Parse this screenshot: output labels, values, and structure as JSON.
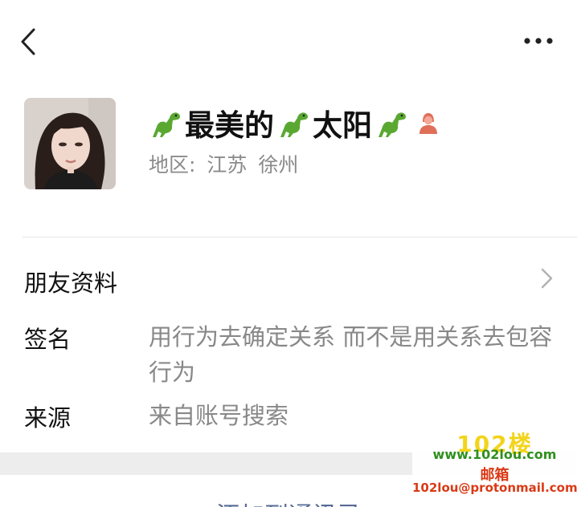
{
  "header": {
    "back_icon": "chevron-left-icon",
    "more_icon": "more-dots-icon"
  },
  "profile": {
    "name_parts": [
      "最美的",
      "太阳"
    ],
    "name_emoji": "dinosaur-emoji",
    "gender_icon": "female-gender-icon",
    "region_label": "地区:",
    "region_province": "江苏",
    "region_city": "徐州"
  },
  "rows": {
    "friend_info_label": "朋友资料",
    "signature_label": "签名",
    "signature_value": "用行为去确定关系 而不是用关系去包容行为",
    "source_label": "来源",
    "source_value": "来自账号搜索"
  },
  "bottom": {
    "action_label": "添加到通讯录"
  },
  "watermark": {
    "logo": "102楼",
    "site": "www.102lou.com",
    "mail_label": "邮箱",
    "email": "102lou@protonmail.com"
  },
  "colors": {
    "link_blue": "#576b95",
    "secondary_text": "#888888",
    "dino_green": "#5aa832",
    "gender_red": "#e06f5a"
  }
}
